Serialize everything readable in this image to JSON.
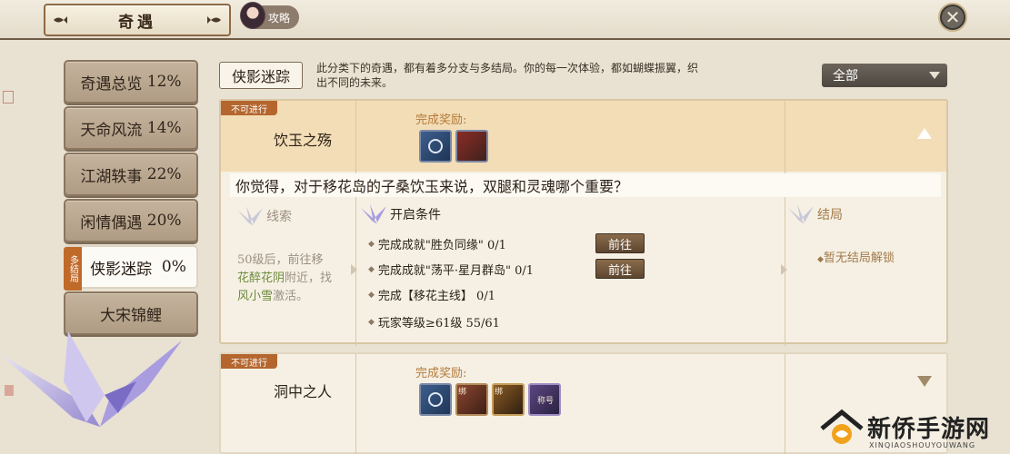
{
  "header": {
    "title": "奇遇",
    "guide_tab": "攻略",
    "close_icon": "close-x"
  },
  "menu": {
    "items": [
      {
        "label": "奇遇总览",
        "percent": "12%"
      },
      {
        "label": "天命风流",
        "percent": "14%"
      },
      {
        "label": "江湖轶事",
        "percent": "22%"
      },
      {
        "label": "闲情偶遇",
        "percent": "20%"
      },
      {
        "label": "侠影迷踪",
        "percent": "0%",
        "tag": "多结局",
        "active": true
      },
      {
        "label": "大宋锦鲤",
        "percent": ""
      }
    ]
  },
  "category": {
    "label": "侠影迷踪",
    "description": "此分类下的奇遇，都有着多分支与多结局。你的每一次体验，都如蝴蝶振翼，织出不同的未来。"
  },
  "filter": {
    "selected": "全部"
  },
  "cards": [
    {
      "status": "不可进行",
      "title": "饮玉之殇",
      "reward_label": "完成奖励:",
      "rewards": [
        {
          "icon": "blue-jade-pendant-icon"
        },
        {
          "icon": "red-scroll-bundle-icon"
        }
      ],
      "question": "你觉得，对于移花岛的子桑饮玉来说，双腿和灵魂哪个重要？",
      "clue_title": "线索",
      "clue_parts": [
        "50级后，前往移",
        "花醉花阴",
        "附近，找",
        "风小雪",
        "激活。"
      ],
      "condition_title": "开启条件",
      "conditions": [
        {
          "text": "完成成就\"胜负同缘\" 0/1",
          "button": "前往"
        },
        {
          "text": "完成成就\"荡平·星月群岛\" 0/1",
          "button": "前往"
        },
        {
          "text": "完成【移花主线】 0/1"
        },
        {
          "text": "玩家等级≥61级  55/61"
        }
      ],
      "ending_title": "结局",
      "ending_text": "暂无结局解锁"
    },
    {
      "status": "不可进行",
      "title": "洞中之人",
      "reward_label": "完成奖励:",
      "rewards": [
        {
          "icon": "blue-jade-pendant-icon"
        },
        {
          "icon": "bound-red-pouch-icon",
          "label": "绑"
        },
        {
          "icon": "bound-gold-ornament-icon",
          "label": "绑"
        },
        {
          "icon": "title-plaque-icon",
          "label": "称号"
        }
      ]
    }
  ],
  "watermark": {
    "text": "新侨手游网",
    "sub": "XINQIAOSHOUYOUWANG"
  }
}
